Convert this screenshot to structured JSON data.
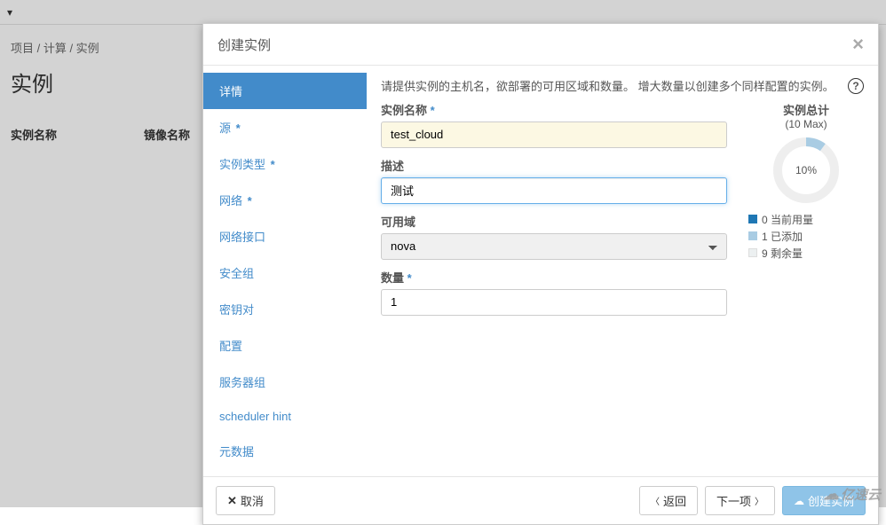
{
  "bg": {
    "topbar_suffix": "▾",
    "breadcrumb": "项目 / 计算 / 实例",
    "title": "实例",
    "th_name": "实例名称",
    "th_image": "镜像名称"
  },
  "modal": {
    "title": "创建实例",
    "nav": {
      "details": "详情",
      "source": "源",
      "flavor": "实例类型",
      "network": "网络",
      "port": "网络接口",
      "secgroup": "安全组",
      "keypair": "密钥对",
      "config": "配置",
      "servergroup": "服务器组",
      "scheduler": "scheduler hint",
      "metadata": "元数据"
    },
    "help_text": "请提供实例的主机名，欲部署的可用区域和数量。 增大数量以创建多个同样配置的实例。",
    "form": {
      "name_label": "实例名称",
      "name_value": "test_cloud",
      "desc_label": "描述",
      "desc_value": "测试",
      "az_label": "可用域",
      "az_value": "nova",
      "count_label": "数量",
      "count_value": "1"
    },
    "total": {
      "title": "实例总计",
      "max": "(10 Max)",
      "percent": "10%",
      "legend_current": "0 当前用量",
      "legend_added": "1 已添加",
      "legend_remain": "9 剩余量"
    },
    "footer": {
      "cancel": "取消",
      "back": "返回",
      "next": "下一项",
      "create": "创建实例"
    }
  },
  "watermark": "亿速云",
  "chart_data": {
    "type": "pie",
    "title": "实例总计 (10 Max)",
    "series": [
      {
        "name": "当前用量",
        "value": 0
      },
      {
        "name": "已添加",
        "value": 1
      },
      {
        "name": "剩余量",
        "value": 9
      }
    ],
    "center_label": "10%"
  }
}
